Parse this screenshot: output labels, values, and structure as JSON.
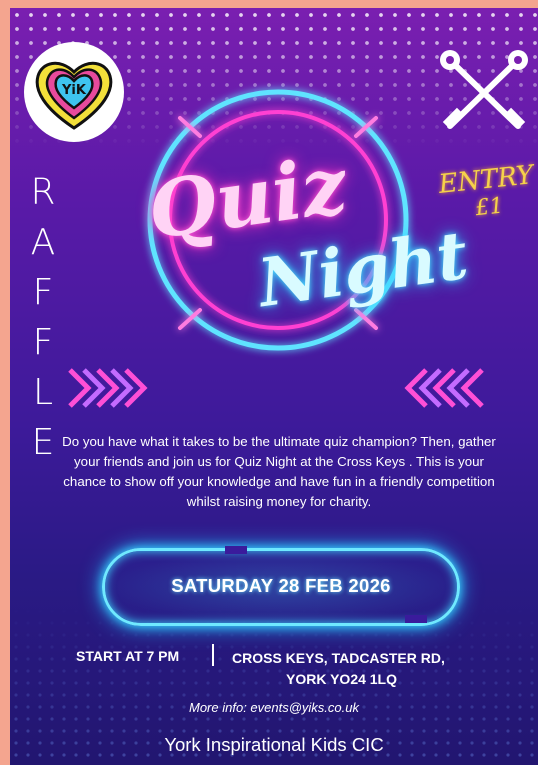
{
  "logo": {
    "text": "YiK"
  },
  "entry": {
    "label": "ENTRY",
    "price": "£1"
  },
  "raffle": {
    "letters": [
      "R",
      "A",
      "F",
      "F",
      "L",
      "E"
    ]
  },
  "title": {
    "line1": "Quiz",
    "line2": "Night"
  },
  "description": "Do you have what it takes to be the ultimate quiz champion? Then, gather your friends and join us for Quiz Night at the Cross Keys . This is your chance to show off your knowledge and have fun in a friendly competition whilst raising money for charity.",
  "event": {
    "date": "SATURDAY 28 FEB 2026",
    "start": "START AT 7 PM",
    "venue_line1": "CROSS KEYS, TADCASTER RD,",
    "venue_line2": "YORK YO24 1LQ"
  },
  "contact": "More info: events@yiks.co.uk",
  "organiser": "York Inspirational Kids CIC",
  "icons": {
    "logo": "heart-logo-icon",
    "keys": "crossed-keys-icon",
    "chevrons": "chevron-arrows-icon"
  },
  "colors": {
    "pink_neon": "#ff3fd2",
    "cyan_neon": "#4fe2ff",
    "gold": "#f5d24a"
  }
}
